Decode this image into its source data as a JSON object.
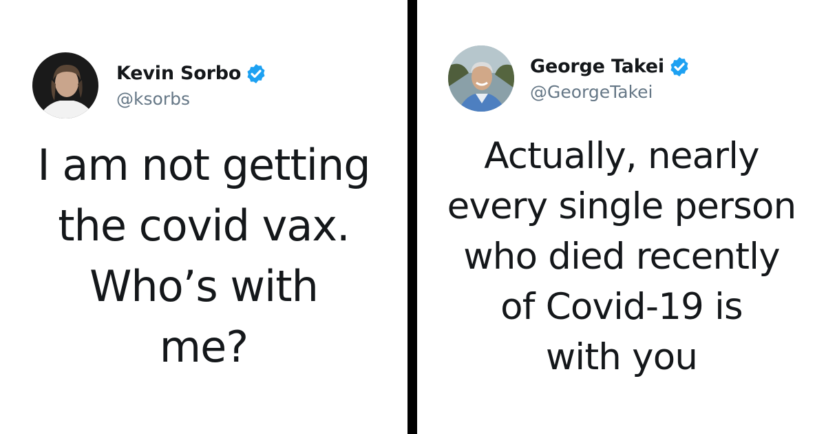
{
  "left_tweet": {
    "display_name": "Kevin Sorbo",
    "handle": "@ksorbs",
    "verified": true,
    "avatar": "avatar-photo",
    "text_lines": [
      "I am not getting",
      "the covid vax.",
      "Who’s with",
      "me?"
    ]
  },
  "right_tweet": {
    "display_name": "George Takei",
    "handle": "@GeorgeTakei",
    "verified": true,
    "avatar": "avatar-photo",
    "text_lines": [
      "Actually, nearly",
      "every single person",
      "who died recently",
      "of Covid-19 is",
      "with you"
    ]
  },
  "colors": {
    "text": "#14171a",
    "handle": "#657786",
    "verified_badge": "#1da1f2",
    "divider": "#000000",
    "background": "#ffffff"
  }
}
